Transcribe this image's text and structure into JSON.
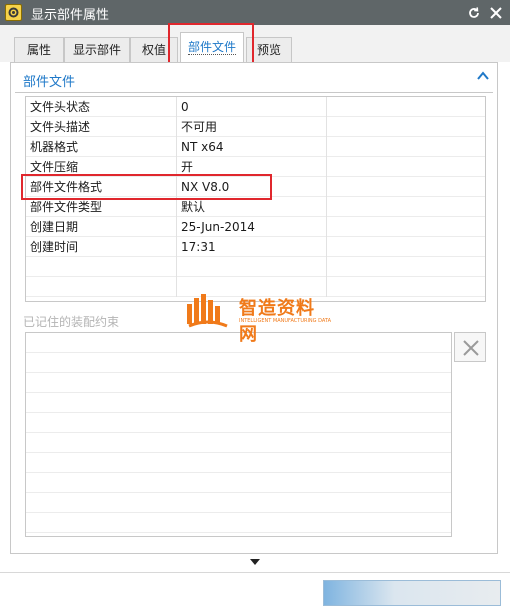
{
  "window": {
    "title": "显示部件属性",
    "refresh_icon": "refresh-icon",
    "close_icon": "close-icon"
  },
  "tabs": [
    {
      "label": "属性"
    },
    {
      "label": "显示部件"
    },
    {
      "label": "权值"
    },
    {
      "label": "部件文件",
      "active": true
    },
    {
      "label": "预览"
    }
  ],
  "section": {
    "title": "部件文件",
    "collapse_icon": "chevron-up-icon"
  },
  "properties": {
    "rows": [
      {
        "name": "文件头状态",
        "value": "0"
      },
      {
        "name": "文件头描述",
        "value": "不可用"
      },
      {
        "name": "机器格式",
        "value": "NT x64"
      },
      {
        "name": "文件压缩",
        "value": "开"
      },
      {
        "name": "部件文件格式",
        "value": "NX V8.0"
      },
      {
        "name": "部件文件类型",
        "value": "默认"
      },
      {
        "name": "创建日期",
        "value": "25-Jun-2014"
      },
      {
        "name": "创建时间",
        "value": "17:31"
      },
      {
        "name": "",
        "value": ""
      },
      {
        "name": "",
        "value": ""
      }
    ]
  },
  "constraints": {
    "label": "已记住的装配约束",
    "delete_icon": "delete-x-icon"
  },
  "watermark": {
    "name": "智造资料网",
    "subtitle": "INTELLIGENT MANUFACTURING DATA"
  },
  "footer": {
    "expand_icon": "expand-down-icon"
  },
  "colors": {
    "titlebar": "#5f6668",
    "accent": "#1e78c8",
    "highlight": "#e0272d",
    "watermark": "#f07a1a"
  }
}
